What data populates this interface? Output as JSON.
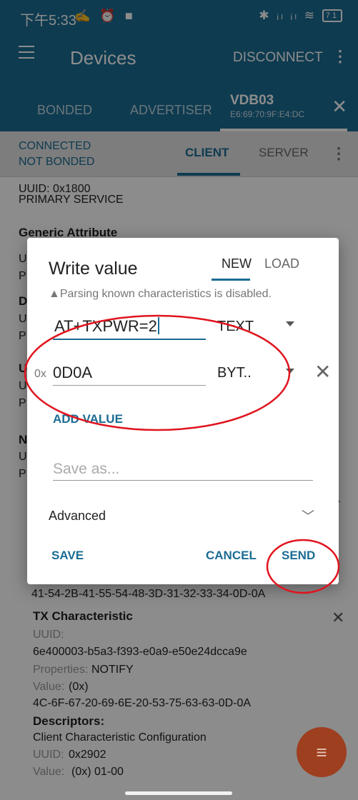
{
  "status_bar": {
    "time": "下午5:33",
    "left_icons": "✍ ⏰ ■",
    "right_icons": "✱ ᵢₗ ᵢₗ ≋",
    "battery": "71"
  },
  "app_bar": {
    "title": "Devices",
    "disconnect": "DISCONNECT"
  },
  "tabs": {
    "bonded": "BONDED",
    "advertiser": "ADVERTISER",
    "device_name": "VDB03",
    "device_mac": "E6:69:70:9F:E4:DC"
  },
  "connection": {
    "line1": "CONNECTED",
    "line2": "NOT BONDED",
    "client": "CLIENT",
    "server": "SERVER"
  },
  "background_list": {
    "uuid_1800": "UUID: 0x1800",
    "primary_service": "PRIMARY SERVICE",
    "generic_attribute": "Generic Attribute",
    "value_bytes": "41-54-2B-41-55-54-48-3D-31-32-33-34-0D-0A",
    "tx_title": "TX Characteristic",
    "tx_uuid_label": "UUID:",
    "tx_uuid": "6e400003-b5a3-f393-e0a9-e50e24dcca9e",
    "tx_props_label": "Properties:",
    "tx_props": "NOTIFY",
    "tx_value_label": "Value:",
    "tx_value_prefix": "(0x)",
    "tx_value": "4C-6F-67-20-69-6E-20-53-75-63-63-0D-0A",
    "descriptors": "Descriptors:",
    "cccd": "Client Characteristic Configuration",
    "desc_uuid_label": "UUID:",
    "desc_uuid": "0x2902",
    "desc_value_label": "Value:",
    "desc_value": "(0x) 01-00"
  },
  "dialog": {
    "title": "Write value",
    "tab_new": "NEW",
    "tab_load": "LOAD",
    "warning": "▲Parsing known characteristics is disabled.",
    "value_text": "AT+TXPWR=2",
    "type_text": "TEXT",
    "bytes_prefix": "0x",
    "bytes_value": "0D0A",
    "type_bytes": "BYT..",
    "add_value": "ADD VALUE",
    "save_as_placeholder": "Save as...",
    "advanced": "Advanced",
    "save": "SAVE",
    "cancel": "CANCEL",
    "send": "SEND"
  },
  "colors": {
    "primary": "#1b6c93",
    "fab": "#9e3f1f",
    "annotation": "#e0141e"
  }
}
